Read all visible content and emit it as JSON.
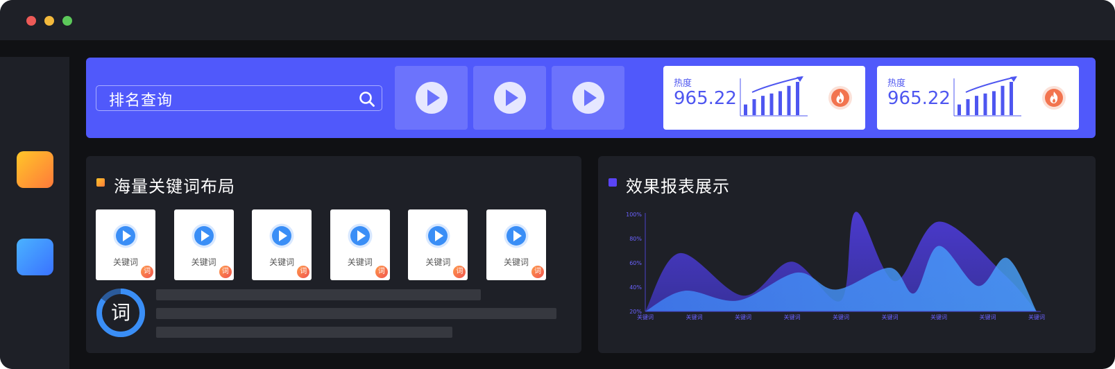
{
  "window": {
    "controls": [
      "close",
      "minimize",
      "zoom"
    ]
  },
  "sidebar": {
    "apps": [
      "orange-app-icon",
      "blue-app-icon"
    ]
  },
  "banner": {
    "search_label": "排名查询",
    "search_icon": "search-icon",
    "video_tiles": 3,
    "heat_cards": [
      {
        "label": "热度",
        "value": "965.22",
        "bars": [
          0.32,
          0.48,
          0.58,
          0.65,
          0.72,
          0.88,
          1.0
        ]
      },
      {
        "label": "热度",
        "value": "965.22",
        "bars": [
          0.32,
          0.48,
          0.58,
          0.65,
          0.72,
          0.88,
          1.0
        ]
      }
    ]
  },
  "keywords_panel": {
    "title": "海量关键词布局",
    "card_label": "关键词",
    "badge": "词",
    "cards": 6,
    "ring_label": "词",
    "ring_progress": 0.85
  },
  "report_panel": {
    "title": "效果报表展示"
  },
  "chart_data": {
    "type": "area",
    "title": "",
    "xlabel": "",
    "ylabel": "",
    "categories": [
      "关键词",
      "关键词",
      "关键词",
      "关键词",
      "关键词",
      "关键词",
      "关键词",
      "关键词",
      "关键词"
    ],
    "y_ticks": [
      "20%",
      "40%",
      "60%",
      "80%",
      "100%"
    ],
    "ylim": [
      20,
      100
    ],
    "grid": false,
    "series": [
      {
        "values": [
          20,
          68,
          33,
          61,
          29,
          102,
          45,
          94,
          50,
          20
        ],
        "x": [
          0,
          0.7,
          2.0,
          3.0,
          4.0,
          4.3,
          5.1,
          6.0,
          7.35,
          8.0
        ],
        "color": "#4a38c9"
      },
      {
        "values": [
          20,
          37,
          29,
          52,
          38,
          56,
          35,
          74,
          41,
          64,
          20
        ],
        "x": [
          0,
          0.8,
          1.9,
          3.1,
          3.9,
          5.0,
          5.5,
          6.0,
          6.8,
          7.4,
          8.0
        ],
        "color": "#3d8df0"
      }
    ]
  },
  "colors": {
    "banner": "#5059fb",
    "panel": "#1e2027",
    "accent_purple": "#5a44f6",
    "accent_blue": "#3a8ef6"
  }
}
